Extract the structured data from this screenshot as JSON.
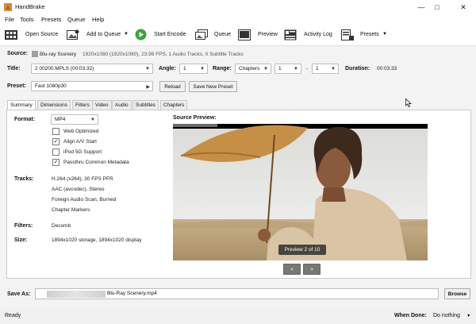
{
  "window": {
    "title": "HandBrake"
  },
  "menu": [
    "File",
    "Tools",
    "Presets",
    "Queue",
    "Help"
  ],
  "toolbar": {
    "open_source": "Open Source",
    "add_to_queue": "Add to Queue",
    "start_encode": "Start Encode",
    "queue": "Queue",
    "preview": "Preview",
    "activity_log": "Activity Log",
    "presets": "Presets"
  },
  "source": {
    "label": "Source:",
    "name": "Blu-ray Scenery",
    "details": "1920x1080 (1920x1080), 23.98 FPS, 1 Audio Tracks, 0 Subtitle Tracks"
  },
  "title_row": {
    "title_label": "Title:",
    "title_value": "2 00200.MPLS (00:03:32)",
    "angle_label": "Angle:",
    "angle_value": "1",
    "range_label": "Range:",
    "range_mode": "Chapters",
    "range_start": "1",
    "range_sep": "-",
    "range_end": "1",
    "duration_label": "Duration:",
    "duration_value": "00:03:33"
  },
  "preset_row": {
    "label": "Preset:",
    "value": "Fast 1080p30",
    "reload": "Reload",
    "save_new": "Save New Preset"
  },
  "tabs": [
    "Summary",
    "Dimensions",
    "Filters",
    "Video",
    "Audio",
    "Subtitles",
    "Chapters"
  ],
  "summary": {
    "format_label": "Format:",
    "format_value": "MP4",
    "options": [
      {
        "label": "Web Optimized",
        "checked": false
      },
      {
        "label": "Align A/V Start",
        "checked": true
      },
      {
        "label": "iPod 5G Support",
        "checked": false
      },
      {
        "label": "Passthru Common Metadata",
        "checked": true
      }
    ],
    "tracks_label": "Tracks:",
    "tracks": [
      "H.264 (x264), 30 FPS PFR",
      "AAC (avcodec), Stereo",
      "Foreign Audio Scan, Burned",
      "Chapter Markers"
    ],
    "filters_label": "Filters:",
    "filters_value": "Decomb",
    "size_label": "Size:",
    "size_value": "1894x1020 storage, 1894x1020 display",
    "preview_label": "Source Preview:",
    "preview_badge": "Preview 2 of 10",
    "prev": "<",
    "next": ">"
  },
  "save": {
    "label": "Save As:",
    "filename": "Blu-Ray Scenery.mp4",
    "browse": "Browse"
  },
  "status": {
    "text": "Ready",
    "when_done_label": "When Done:",
    "when_done_value": "Do nothing"
  },
  "colors": {
    "start_green": "#3aa63a",
    "accent_blue": "#1e6fd0"
  }
}
